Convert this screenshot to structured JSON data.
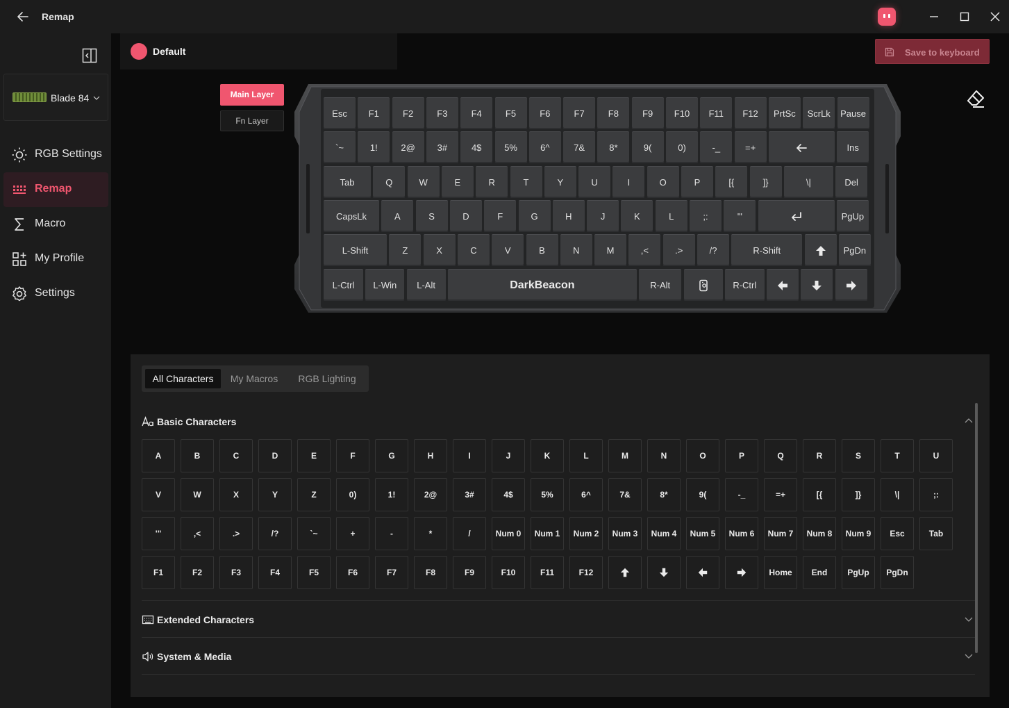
{
  "app": {
    "window_title": "Remap"
  },
  "sidebar": {
    "device": {
      "name": "Blade 84"
    },
    "nav": [
      {
        "label": "RGB Settings",
        "icon": "sun-icon",
        "active": false
      },
      {
        "label": "Remap",
        "icon": "keyboard-grid-icon",
        "active": true
      },
      {
        "label": "Macro",
        "icon": "sigma-icon",
        "active": false
      },
      {
        "label": "My Profile",
        "icon": "apps-add-icon",
        "active": false
      },
      {
        "label": "Settings",
        "icon": "gear-icon",
        "active": false
      }
    ]
  },
  "header": {
    "profile_name": "Default",
    "save_label": "Save to keyboard"
  },
  "layers": {
    "main": "Main Layer",
    "fn": "Fn Layer"
  },
  "keyboard": {
    "rows": [
      [
        "Esc",
        "F1",
        "F2",
        "F3",
        "F4",
        "F5",
        "F6",
        "F7",
        "F8",
        "F9",
        "F10",
        "F11",
        "F12",
        "PrtSc",
        "ScrLk",
        "Pause"
      ],
      [
        "`~",
        "1!",
        "2@",
        "3#",
        "4$",
        "5%",
        "6^",
        "7&",
        "8*",
        "9(",
        "0)",
        "-_",
        "=+",
        "backspace-icon",
        "Ins"
      ],
      [
        "Tab",
        "Q",
        "W",
        "E",
        "R",
        "T",
        "Y",
        "U",
        "I",
        "O",
        "P",
        "[{",
        "]}",
        "\\|",
        "Del"
      ],
      [
        "CapsLk",
        "A",
        "S",
        "D",
        "F",
        "G",
        "H",
        "J",
        "K",
        "L",
        ";:",
        "'\"",
        "enter-icon",
        "PgUp"
      ],
      [
        "L-Shift",
        "Z",
        "X",
        "C",
        "V",
        "B",
        "N",
        "M",
        ",<",
        ".>",
        "/?",
        "R-Shift",
        "arrow-up-icon",
        "PgDn"
      ],
      [
        "L-Ctrl",
        "L-Win",
        "L-Alt",
        "DarkBeacon",
        "R-Alt",
        "fn-device-icon",
        "R-Ctrl",
        "arrow-left-icon",
        "arrow-down-icon",
        "arrow-right-icon"
      ]
    ]
  },
  "panel": {
    "tabs": [
      {
        "label": "All Characters",
        "active": true
      },
      {
        "label": "My Macros",
        "active": false
      },
      {
        "label": "RGB Lighting",
        "active": false
      }
    ],
    "sections": {
      "basic": "Basic Characters",
      "extended": "Extended Characters",
      "system": "System & Media"
    },
    "basic_characters": [
      "A",
      "B",
      "C",
      "D",
      "E",
      "F",
      "G",
      "H",
      "I",
      "J",
      "K",
      "L",
      "M",
      "N",
      "O",
      "P",
      "Q",
      "R",
      "S",
      "T",
      "U",
      "V",
      "W",
      "X",
      "Y",
      "Z",
      "0)",
      "1!",
      "2@",
      "3#",
      "4$",
      "5%",
      "6^",
      "7&",
      "8*",
      "9(",
      "-_",
      "=+",
      "[{",
      "]}",
      "\\|",
      ";:",
      "'\"",
      ",<",
      ".>",
      "/?",
      "`~",
      "+",
      "-",
      "*",
      "/",
      "Num 0",
      "Num 1",
      "Num 2",
      "Num 3",
      "Num 4",
      "Num 5",
      "Num 6",
      "Num 7",
      "Num 8",
      "Num 9",
      "Esc",
      "Tab",
      "F1",
      "F2",
      "F3",
      "F4",
      "F5",
      "F6",
      "F7",
      "F8",
      "F9",
      "F10",
      "F11",
      "F12",
      "arrow-up-icon",
      "arrow-down-icon",
      "arrow-left-icon",
      "arrow-right-icon",
      "Home",
      "End",
      "PgUp",
      "PgDn"
    ]
  },
  "colors": {
    "accent": "#f0566f",
    "save_bg": "#7d2a36",
    "key_bg": "#3b3c3e",
    "panel_bg": "#1e1e1e"
  }
}
